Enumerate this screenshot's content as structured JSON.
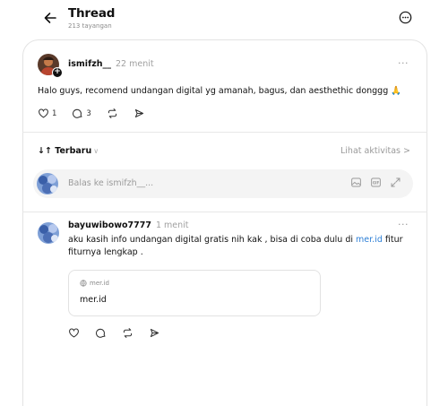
{
  "header": {
    "title": "Thread",
    "views": "213 tayangan"
  },
  "post": {
    "username": "ismifzh__",
    "time": "22 menit",
    "text": "Halo guys, recomend undangan digital yg amanah, bagus, dan aesthethic donggg",
    "emoji": "🙏",
    "like_count": "1",
    "reply_count": "3",
    "more": "···"
  },
  "sort": {
    "label": "Terbaru",
    "icon": "↓↑",
    "chevron": "∨",
    "activity_link": "Lihat aktivitas",
    "activity_chevron": ">"
  },
  "reply_box": {
    "placeholder": "Balas ke ismifzh__..."
  },
  "reply": {
    "username": "bayuwibowo7777",
    "time": "1 menit",
    "text_before": "aku kasih info undangan digital gratis nih kak , bisa di coba dulu di ",
    "link": "mer.id",
    "text_after": " fitur fiturnya lengkap .",
    "more": "···",
    "preview_domain": "mer.id",
    "preview_title": "mer.id"
  },
  "colors": {
    "link": "#2d7fd6",
    "muted": "#9a9a9a",
    "text": "#101010"
  }
}
